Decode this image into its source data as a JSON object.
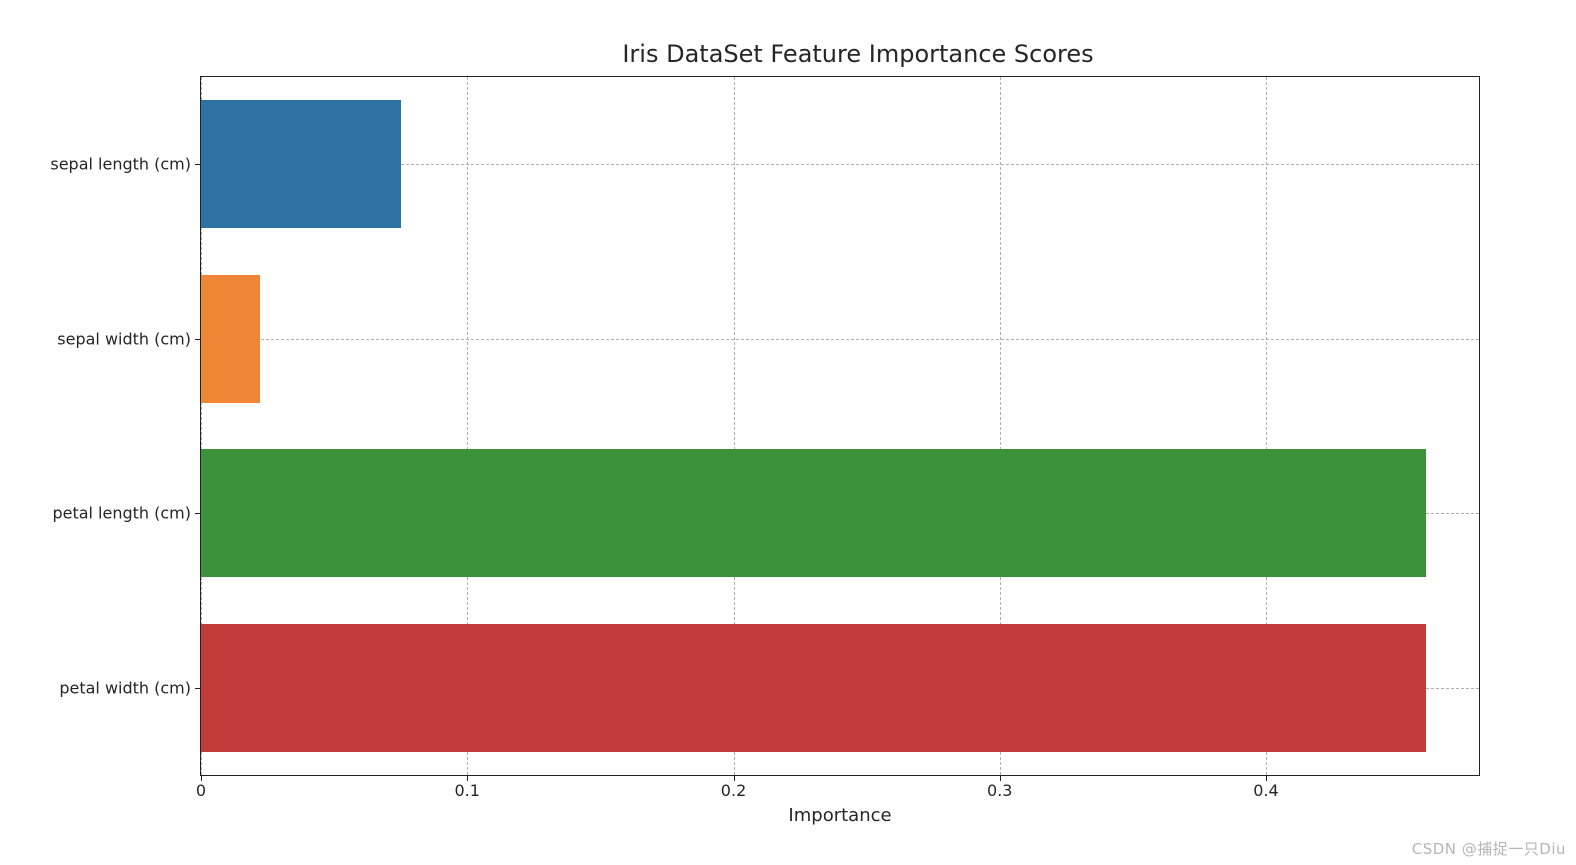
{
  "chart_data": {
    "type": "bar",
    "orientation": "horizontal",
    "title": "Iris DataSet Feature Importance Scores",
    "xlabel": "Importance",
    "ylabel": "",
    "categories": [
      "sepal length (cm)",
      "sepal width (cm)",
      "petal length (cm)",
      "petal width (cm)"
    ],
    "values": [
      0.075,
      0.022,
      0.46,
      0.46
    ],
    "colors": [
      "#2E72A4",
      "#EF8636",
      "#3B923B",
      "#C03B3B"
    ],
    "xlim": [
      0.0,
      0.48
    ],
    "xticks": [
      0.0,
      0.1,
      0.2,
      0.3,
      0.4
    ],
    "grid": true
  },
  "watermark": "CSDN @捕捉一只Diu"
}
